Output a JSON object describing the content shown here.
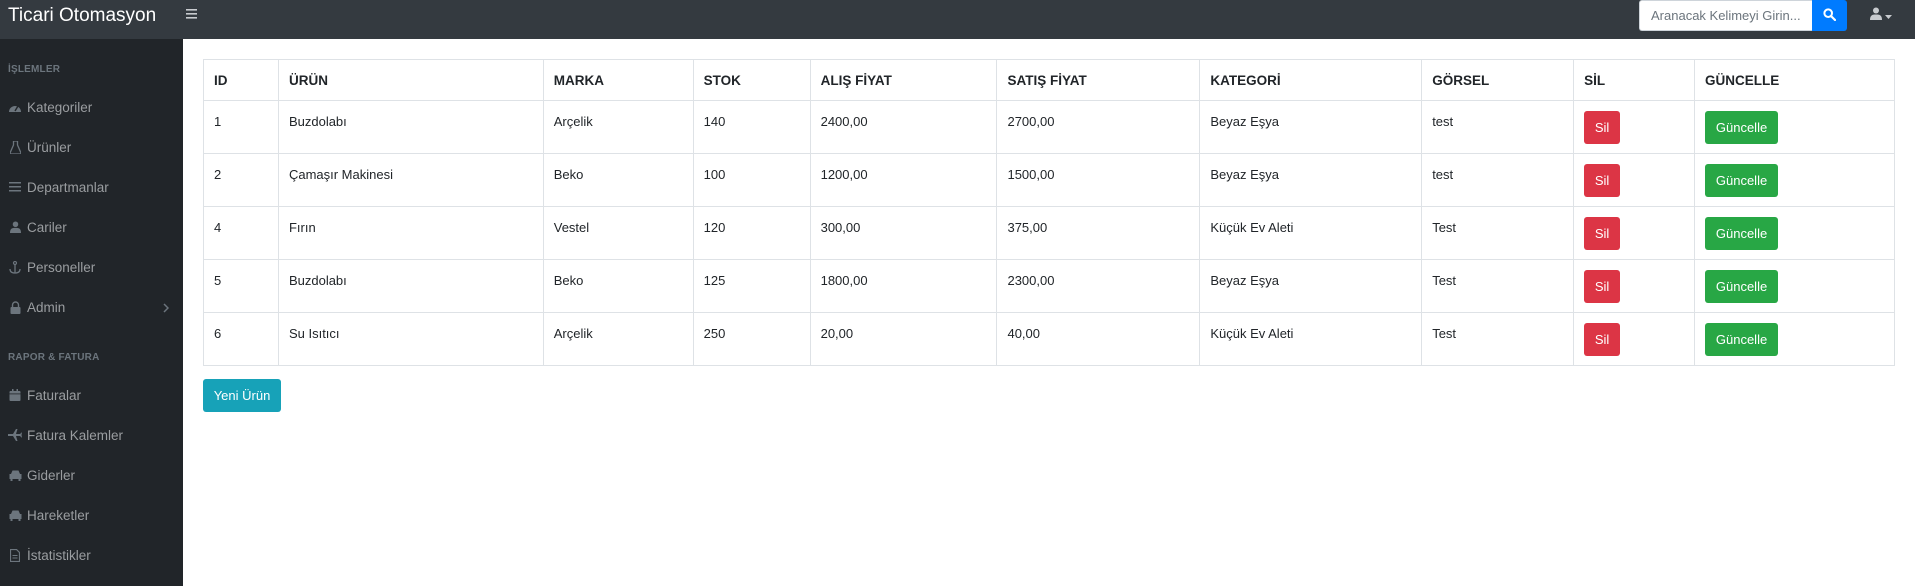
{
  "app": {
    "title": "Ticari Otomasyon"
  },
  "search": {
    "placeholder": "Aranacak Kelimeyi Girin...",
    "icon": "search-icon"
  },
  "user": {
    "icon": "user-icon"
  },
  "sidebar": {
    "section1": "İŞLEMLER",
    "items1": [
      {
        "label": "Kategoriler",
        "icon": "tachometer-icon"
      },
      {
        "label": "Ürünler",
        "icon": "flask-icon"
      },
      {
        "label": "Departmanlar",
        "icon": "list-icon"
      },
      {
        "label": "Cariler",
        "icon": "user-icon"
      },
      {
        "label": "Personeller",
        "icon": "anchor-icon"
      },
      {
        "label": "Admin",
        "icon": "lock-icon"
      }
    ],
    "section2": "RAPOR & FATURA",
    "items2": [
      {
        "label": "Faturalar",
        "icon": "calendar-icon"
      },
      {
        "label": "Fatura Kalemler",
        "icon": "plane-icon"
      },
      {
        "label": "Giderler",
        "icon": "car-icon"
      },
      {
        "label": "Hareketler",
        "icon": "car-icon"
      },
      {
        "label": "İstatistikler",
        "icon": "file-icon"
      }
    ]
  },
  "table": {
    "headers": [
      "ID",
      "ÜRÜN",
      "MARKA",
      "STOK",
      "ALIŞ FİYAT",
      "SATIŞ FİYAT",
      "KATEGORİ",
      "GÖRSEL",
      "SİL",
      "GÜNCELLE"
    ],
    "rows": [
      {
        "id": "1",
        "urun": "Buzdolabı",
        "marka": "Arçelik",
        "stok": "140",
        "alis": "2400,00",
        "satis": "2700,00",
        "kategori": "Beyaz Eşya",
        "gorsel": "test",
        "sil": "Sil",
        "guncelle": "Güncelle"
      },
      {
        "id": "2",
        "urun": "Çamaşır Makinesi",
        "marka": "Beko",
        "stok": "100",
        "alis": "1200,00",
        "satis": "1500,00",
        "kategori": "Beyaz Eşya",
        "gorsel": "test",
        "sil": "Sil",
        "guncelle": "Güncelle"
      },
      {
        "id": "4",
        "urun": "Fırın",
        "marka": "Vestel",
        "stok": "120",
        "alis": "300,00",
        "satis": "375,00",
        "kategori": "Küçük Ev Aleti",
        "gorsel": "Test",
        "sil": "Sil",
        "guncelle": "Güncelle"
      },
      {
        "id": "5",
        "urun": "Buzdolabı",
        "marka": "Beko",
        "stok": "125",
        "alis": "1800,00",
        "satis": "2300,00",
        "kategori": "Beyaz Eşya",
        "gorsel": "Test",
        "sil": "Sil",
        "guncelle": "Güncelle"
      },
      {
        "id": "6",
        "urun": "Su Isıtıcı",
        "marka": "Arçelik",
        "stok": "250",
        "alis": "20,00",
        "satis": "40,00",
        "kategori": "Küçük Ev Aleti",
        "gorsel": "Test",
        "sil": "Sil",
        "guncelle": "Güncelle"
      }
    ]
  },
  "actions": {
    "new_product": "Yeni Ürün"
  },
  "colors": {
    "topbar": "#343a40",
    "sidebar": "#212529",
    "primary": "#007bff",
    "danger": "#dc3545",
    "success": "#28a745",
    "info": "#17a2b8"
  }
}
